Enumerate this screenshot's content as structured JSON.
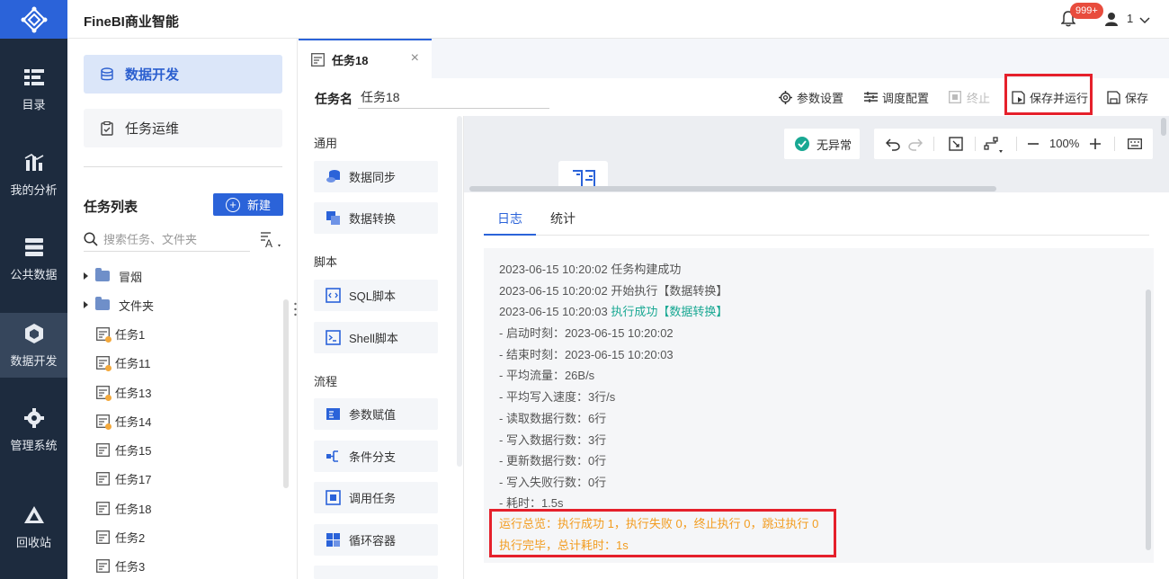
{
  "app_title": "FineBI商业智能",
  "header": {
    "notification_count": "999+",
    "user_name": "1"
  },
  "nav": [
    {
      "label": "目录",
      "icon": "catalog-icon"
    },
    {
      "label": "我的分析",
      "icon": "chart-icon"
    },
    {
      "label": "公共数据",
      "icon": "database-icon"
    },
    {
      "label": "数据开发",
      "icon": "cube-icon",
      "active": true
    },
    {
      "label": "管理系统",
      "icon": "gear-icon"
    },
    {
      "label": "回收站",
      "icon": "recycle-icon"
    }
  ],
  "sidebar": {
    "dev_label": "数据开发",
    "ops_label": "任务运维",
    "list_title": "任务列表",
    "new_label": "新建",
    "search_placeholder": "搜索任务、文件夹",
    "tree": [
      {
        "type": "folder",
        "label": "冒烟"
      },
      {
        "type": "folder",
        "label": "文件夹"
      },
      {
        "type": "task",
        "label": "任务1",
        "dot": true
      },
      {
        "type": "task",
        "label": "任务11",
        "dot": true
      },
      {
        "type": "task",
        "label": "任务13",
        "dot": true
      },
      {
        "type": "task",
        "label": "任务14",
        "dot": true
      },
      {
        "type": "task",
        "label": "任务15",
        "dot": false
      },
      {
        "type": "task",
        "label": "任务17",
        "dot": false
      },
      {
        "type": "task",
        "label": "任务18",
        "dot": false
      },
      {
        "type": "task",
        "label": "任务2",
        "dot": false
      },
      {
        "type": "task",
        "label": "任务3",
        "dot": false
      }
    ]
  },
  "tab": {
    "label": "任务18"
  },
  "task": {
    "name_label": "任务名",
    "name_value": "任务18"
  },
  "toolbar": {
    "params": "参数设置",
    "schedule": "调度配置",
    "stop": "终止",
    "save_run": "保存并运行",
    "save": "保存"
  },
  "palette": {
    "sections": [
      {
        "title": "通用",
        "items": [
          "数据同步",
          "数据转换"
        ]
      },
      {
        "title": "脚本",
        "items": [
          "SQL脚本",
          "Shell脚本"
        ]
      },
      {
        "title": "流程",
        "items": [
          "参数赋值",
          "条件分支",
          "调用任务",
          "循环容器"
        ]
      }
    ]
  },
  "canvas": {
    "status": "无异常",
    "zoom": "100%"
  },
  "log": {
    "tabs": [
      "日志",
      "统计"
    ],
    "lines": [
      {
        "text": "2023-06-15 10:20:02 任务构建成功"
      },
      {
        "text": "2023-06-15 10:20:02 开始执行【数据转换】"
      },
      {
        "text": "2023-06-15 10:20:03 ",
        "highlight": "执行成功【数据转换】"
      },
      {
        "text": "- 启动时刻：2023-06-15 10:20:02"
      },
      {
        "text": "- 结束时刻：2023-06-15 10:20:03"
      },
      {
        "text": "- 平均流量：26B/s"
      },
      {
        "text": "- 平均写入速度：3行/s"
      },
      {
        "text": "- 读取数据行数：6行"
      },
      {
        "text": "- 写入数据行数：3行"
      },
      {
        "text": "- 更新数据行数：0行"
      },
      {
        "text": "- 写入失败行数：0行"
      },
      {
        "text": "- 耗时：1.5s"
      }
    ],
    "summary": "运行总览：执行成功 1，执行失败 0，终止执行 0，跳过执行 0",
    "done": "执行完毕，总计耗时：1s"
  },
  "colors": {
    "primary": "#2b63d9",
    "nav_bg": "#1d2b3e",
    "success": "#19a893",
    "warning": "#f29c1f",
    "highlight_box": "#e5202b"
  }
}
